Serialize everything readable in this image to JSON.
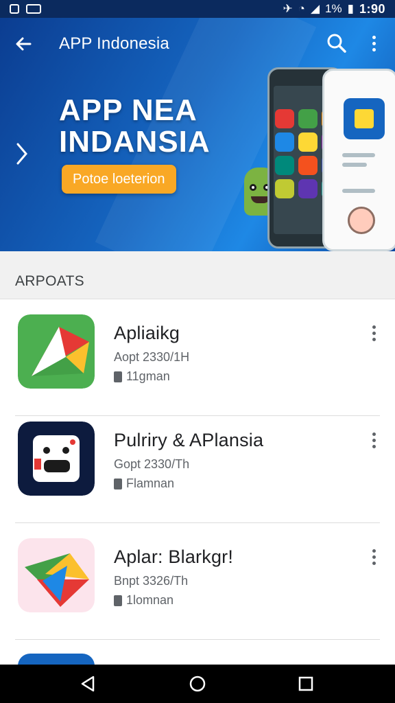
{
  "status_bar": {
    "time": "1:90",
    "battery": "1%"
  },
  "header": {
    "title": "APP Indonesia",
    "back_icon": "arrow-left-icon",
    "search_icon": "search-icon",
    "more_icon": "more-vert-icon"
  },
  "banner": {
    "headline_line1": "APP NEA",
    "headline_line2": "INDANSIA",
    "chip_label": "Potoe loeterion"
  },
  "section": {
    "title": "ARPOATS"
  },
  "apps": [
    {
      "title": "Apliaikg",
      "subtitle": "Aopt 2330/1H",
      "meta": "11gman"
    },
    {
      "title": "Pulriry & APlansia",
      "subtitle": "Gopt 2330/Th",
      "meta": "Flamnan"
    },
    {
      "title": "Aplar: Blarkgr!",
      "subtitle": "Bnpt 3326/Th",
      "meta": "1lomnan"
    }
  ],
  "nav": {
    "back": "nav-back-icon",
    "home": "nav-home-icon",
    "recents": "nav-recents-icon"
  },
  "colors": {
    "banner_primary": "#1565c0",
    "chip": "#f9a825",
    "status_bar": "#0b2a5e"
  }
}
